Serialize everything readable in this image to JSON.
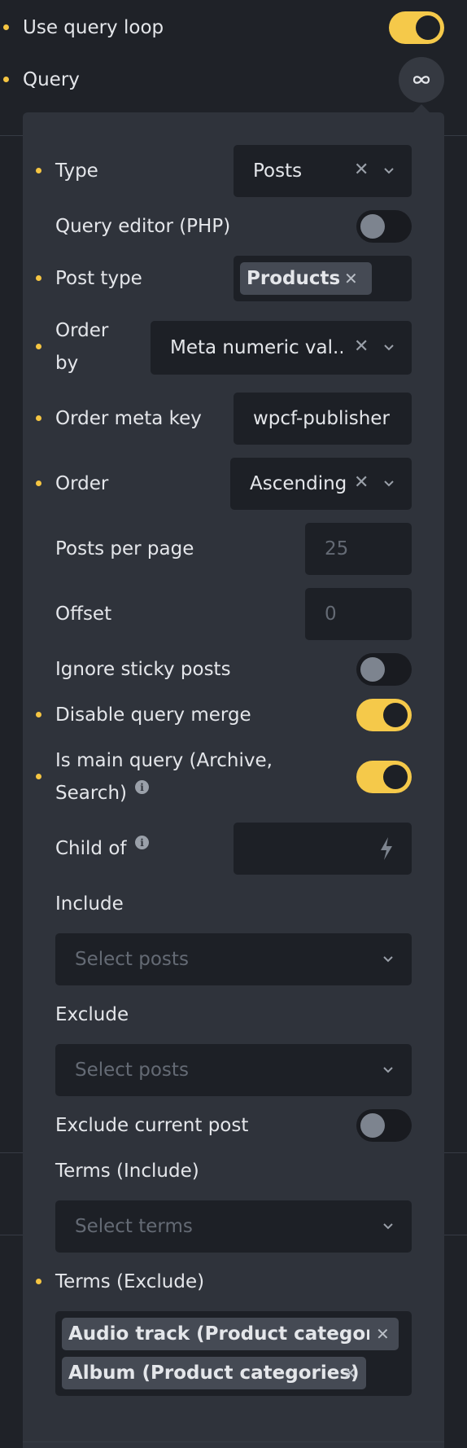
{
  "top": {
    "use_query_loop_label": "Use query loop",
    "use_query_loop_on": true,
    "query_label": "Query",
    "query_icon": "infinity-icon"
  },
  "query": {
    "type": {
      "label": "Type",
      "value": "Posts"
    },
    "query_editor": {
      "label": "Query editor (PHP)",
      "on": false
    },
    "post_type": {
      "label": "Post type",
      "tag": "Products"
    },
    "order_by": {
      "label_line1": "Order",
      "label_line2": "by",
      "value": "Meta numeric val..."
    },
    "order_meta_key": {
      "label": "Order meta key",
      "value": "wpcf-publisher"
    },
    "order": {
      "label": "Order",
      "value": "Ascending"
    },
    "posts_per_page": {
      "label": "Posts per page",
      "placeholder": "25"
    },
    "offset": {
      "label": "Offset",
      "placeholder": "0"
    },
    "ignore_sticky": {
      "label": "Ignore sticky posts",
      "on": false
    },
    "disable_merge": {
      "label": "Disable query merge",
      "on": true
    },
    "is_main_query": {
      "label_line1": "Is main query (Archive,",
      "label_line2": "Search)",
      "on": true
    },
    "child_of": {
      "label": "Child of",
      "icon": "lightning-icon"
    },
    "include": {
      "label": "Include",
      "placeholder": "Select posts"
    },
    "exclude": {
      "label": "Exclude",
      "placeholder": "Select posts"
    },
    "exclude_current": {
      "label": "Exclude current post",
      "on": false
    },
    "terms_include": {
      "label": "Terms (Include)",
      "placeholder": "Select terms"
    },
    "terms_exclude": {
      "label": "Terms (Exclude)",
      "tags": [
        "Audio track (Product categor...",
        "Album (Product categories)"
      ]
    }
  },
  "colors": {
    "accent": "#f5c542",
    "background": "#1f2228",
    "panel": "#2f333b",
    "field": "#1d2026"
  }
}
